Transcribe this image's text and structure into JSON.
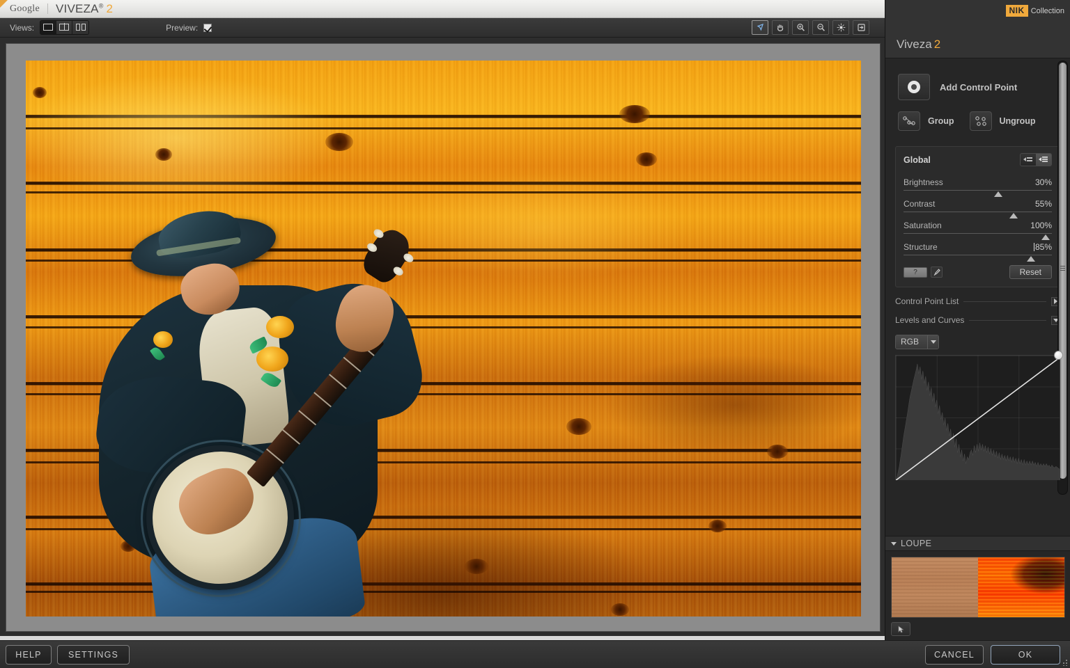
{
  "titlebar": {
    "brand": "Google",
    "app_name": "VIVEZA",
    "app_sup": "®",
    "app_version": "2"
  },
  "toolbar": {
    "views_label": "Views:",
    "view_buttons": [
      {
        "name": "single-view",
        "icon": "single-pane-icon",
        "active": true
      },
      {
        "name": "split-view",
        "icon": "split-pane-icon",
        "active": false
      },
      {
        "name": "side-by-side-view",
        "icon": "dual-pane-icon",
        "active": false
      }
    ],
    "preview_label": "Preview:",
    "preview_checked": true,
    "tools": [
      {
        "name": "select-tool",
        "icon": "cursor-arrow-icon",
        "active": true
      },
      {
        "name": "pan-tool",
        "icon": "hand-icon",
        "active": false
      },
      {
        "name": "zoom-in-tool",
        "icon": "magnifier-plus-icon",
        "active": false
      },
      {
        "name": "zoom-out-tool",
        "icon": "magnifier-minus-icon",
        "active": false
      },
      {
        "name": "brightness-tool",
        "icon": "sun-burst-icon",
        "active": false
      },
      {
        "name": "export-tool",
        "icon": "export-arrow-icon",
        "active": false
      }
    ]
  },
  "panel": {
    "logo_badge": "NIK",
    "logo_word": "Collection",
    "title": "Viveza",
    "title_version": "2",
    "add_control_point": "Add Control Point",
    "group": "Group",
    "ungroup": "Ungroup",
    "global": {
      "title": "Global",
      "sliders": [
        {
          "label": "Brightness",
          "value": "30%",
          "pos": 64
        },
        {
          "label": "Contrast",
          "value": "55%",
          "pos": 74
        },
        {
          "label": "Saturation",
          "value": "100%",
          "pos": 96
        },
        {
          "label": "Structure",
          "value": "85%",
          "pos": 86,
          "editing": true
        }
      ],
      "help_btn": "?",
      "reset": "Reset"
    },
    "control_point_list": "Control Point List",
    "levels_and_curves": "Levels and Curves",
    "channel": "RGB",
    "loupe_title": "LOUPE"
  },
  "footer": {
    "help": "HELP",
    "settings": "SETTINGS",
    "cancel": "CANCEL",
    "ok": "OK"
  },
  "colors": {
    "accent": "#f0a93c",
    "panel_bg": "#262626",
    "canvas_bg": "#8c8c8c",
    "text": "#c3c3c3"
  }
}
